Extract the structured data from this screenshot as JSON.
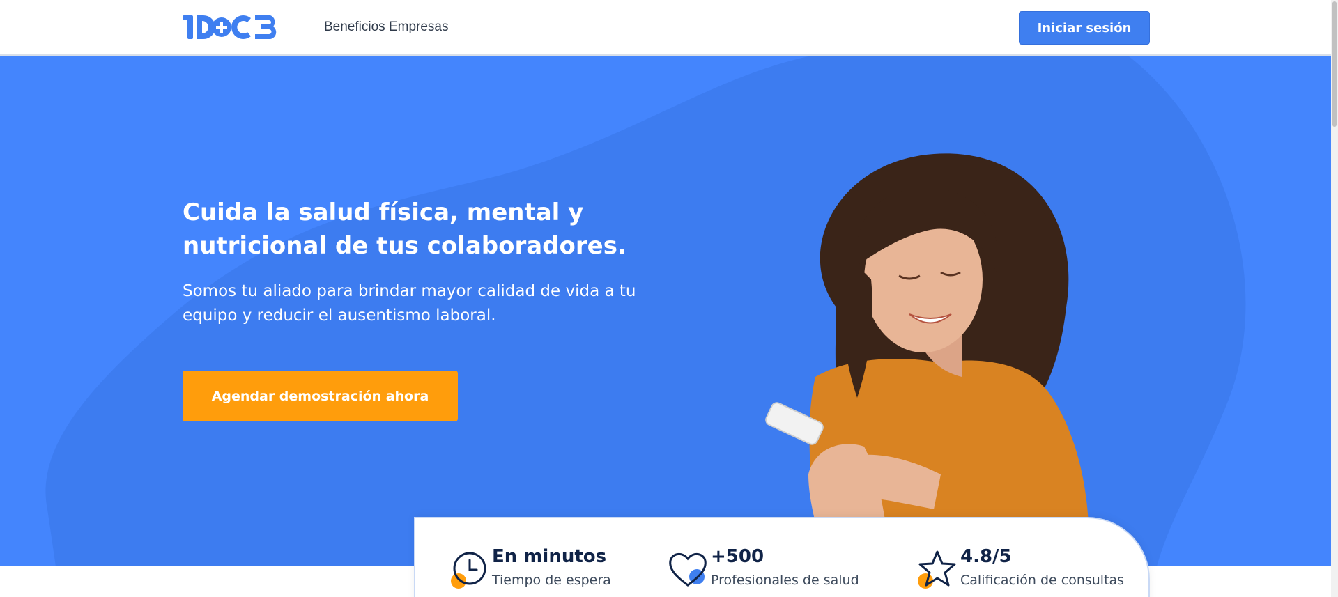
{
  "header": {
    "logo_text": "1DOC3",
    "nav_link": "Beneficios Empresas",
    "login_label": "Iniciar sesión"
  },
  "hero": {
    "title_line1": "Cuida la salud física, mental y",
    "title_line2": "nutricional de tus colaboradores.",
    "subtitle": "Somos tu aliado para brindar mayor calidad de vida a tu equipo y reducir el ausentismo laboral.",
    "cta_label": "Agendar demostración ahora"
  },
  "stats": [
    {
      "value": "En minutos",
      "label": "Tiempo de espera",
      "icon": "clock-icon"
    },
    {
      "value": "+500",
      "label": "Profesionales de salud",
      "icon": "heart-icon"
    },
    {
      "value": "4.8/5",
      "label": "Calificación de consultas",
      "icon": "star-icon"
    }
  ],
  "colors": {
    "brand_blue": "#4485fd",
    "button_blue": "#3f7ff0",
    "cta_orange": "#ff9d0c",
    "navy_text": "#102347",
    "skin": "#e8b596",
    "hair": "#3a2418",
    "shirt": "#d98322"
  }
}
